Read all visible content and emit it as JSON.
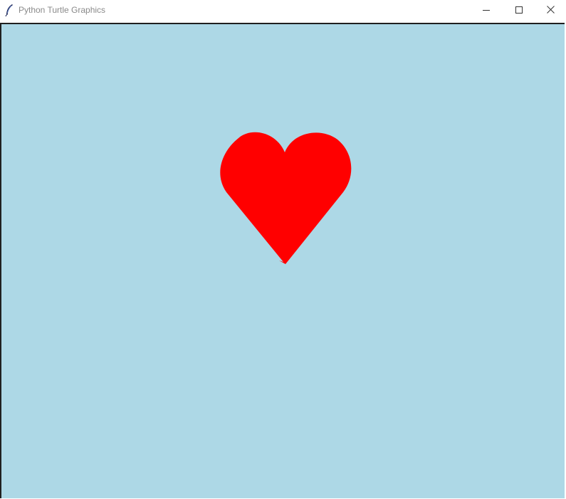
{
  "window": {
    "title": "Python Turtle Graphics",
    "icon": "feather-icon",
    "controls": {
      "minimize_icon": "minimize-icon",
      "maximize_icon": "maximize-icon",
      "close_icon": "close-icon"
    }
  },
  "canvas": {
    "background_color": "#add8e6",
    "shapes": [
      {
        "type": "heart",
        "fill_color": "#ff0000"
      }
    ]
  },
  "colors": {
    "titlebar_bg": "#ffffff",
    "title_text": "#8a8a8a",
    "frame_border": "#202020"
  }
}
